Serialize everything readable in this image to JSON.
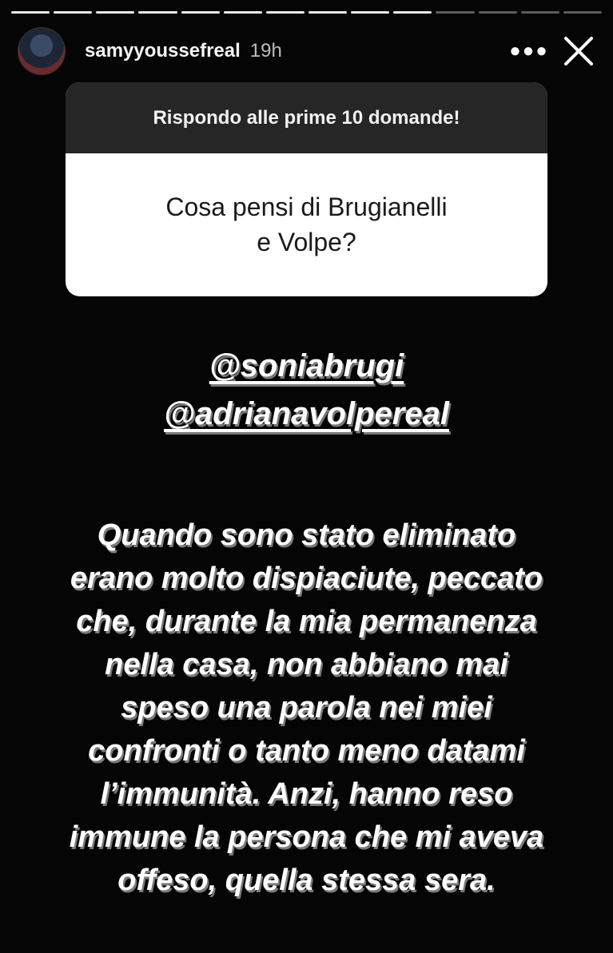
{
  "progress": {
    "total": 14,
    "completed": 10
  },
  "header": {
    "username": "samyyoussefreal",
    "time": "19h",
    "more_icon": "more-horizontal-icon",
    "close_icon": "close-icon"
  },
  "question_card": {
    "prompt": "Rispondo alle prime 10 domande!",
    "question": "Cosa pensi di Brugianelli\ne Volpe?"
  },
  "mentions": [
    "@soniabrugi",
    "@adrianavolpereal"
  ],
  "answer": "Quando sono stato eliminato\nerano molto dispiaciute, peccato\nche, durante la mia permanenza\nnella casa, non abbiano mai\nspeso una parola nei miei\nconfronti o tanto meno datami\nl’immunità. Anzi, hanno reso\nimmune la persona che mi aveva\noffeso, quella stessa sera."
}
